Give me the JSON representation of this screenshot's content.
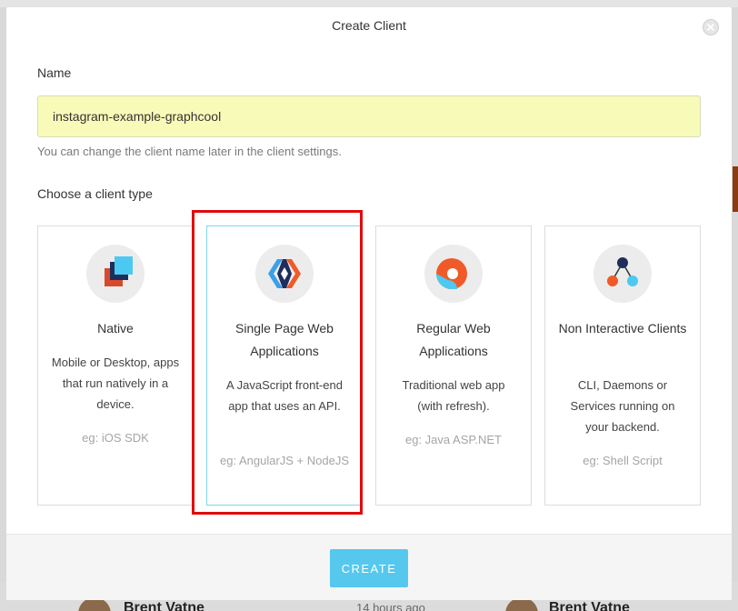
{
  "modal": {
    "title": "Create Client",
    "close_icon": "close-icon"
  },
  "name_field": {
    "label": "Name",
    "value": "instagram-example-graphcool",
    "hint": "You can change the client name later in the client settings."
  },
  "client_type": {
    "label": "Choose a client type",
    "selected": "single-page-web-applications",
    "cards": [
      {
        "id": "native",
        "icon": "native-layers-icon",
        "title": "Native",
        "description": "Mobile or Desktop, apps that run natively in a device.",
        "example": "eg: iOS SDK"
      },
      {
        "id": "single-page-web-applications",
        "icon": "spa-diamond-icon",
        "title": "Single Page Web Applications",
        "description": "A JavaScript front-end app that uses an API.",
        "example": "eg: AngularJS + NodeJS"
      },
      {
        "id": "regular-web-applications",
        "icon": "regular-web-app-icon",
        "title": "Regular Web Applications",
        "description": "Traditional web app (with refresh).",
        "example": "eg: Java ASP.NET"
      },
      {
        "id": "non-interactive-clients",
        "icon": "non-interactive-nodes-icon",
        "title": "Non Interactive Clients",
        "description": "CLI, Daemons or Services running on your backend.",
        "example": "eg: Shell Script"
      }
    ]
  },
  "footer": {
    "create_label": "CREATE"
  },
  "background": {
    "left_author": "Brent Vatne",
    "timestamp": "14 hours ago",
    "right_author": "Brent Vatne"
  },
  "colors": {
    "accent": "#56c8ee",
    "input_bg": "#f8fbb8",
    "highlight": "#e10b0b",
    "selected_border": "#7fd6ea"
  }
}
